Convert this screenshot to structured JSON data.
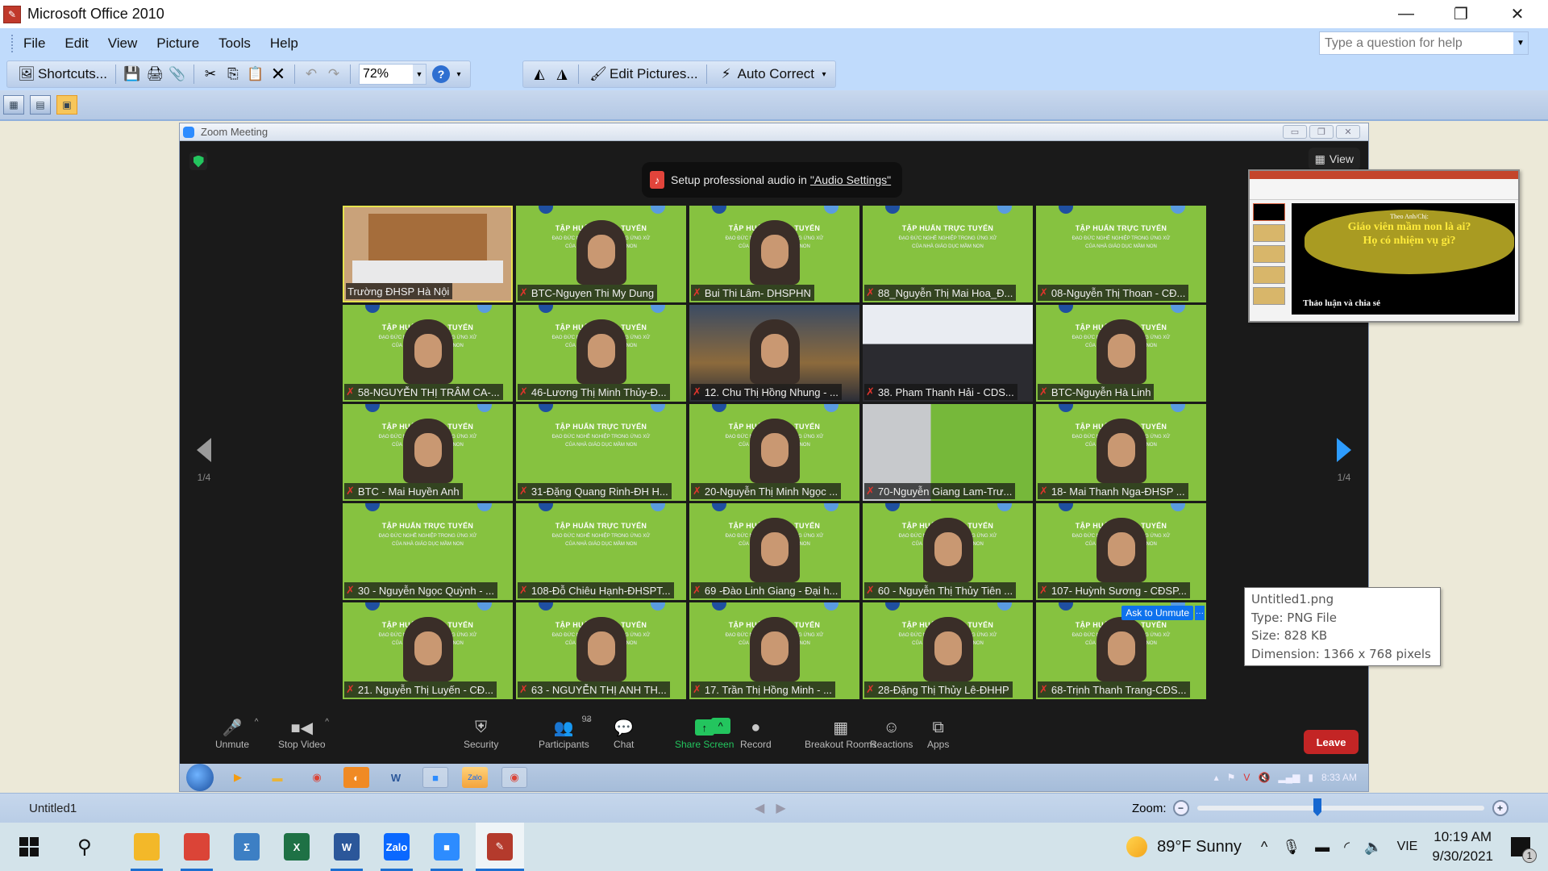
{
  "window": {
    "title": "Microsoft Office 2010",
    "app_icon": "picture-manager-icon",
    "controls": {
      "minimize": "—",
      "restore": "❐",
      "close": "✕"
    }
  },
  "menubar": {
    "items": [
      {
        "label": "File"
      },
      {
        "label": "Edit"
      },
      {
        "label": "View"
      },
      {
        "label": "Picture"
      },
      {
        "label": "Tools"
      },
      {
        "label": "Help"
      }
    ],
    "help_placeholder": "Type a question for help"
  },
  "toolbar": {
    "shortcuts_label": "Shortcuts...",
    "zoom_value": "72%",
    "edit_pictures_label": "Edit Pictures...",
    "auto_correct_label": "Auto Correct",
    "icons": [
      "save-icon",
      "print-icon",
      "attach-icon",
      "cut-icon",
      "copy-icon",
      "paste-icon",
      "delete-icon",
      "undo-icon",
      "redo-icon",
      "help-icon",
      "rotate-left-icon",
      "rotate-right-icon"
    ]
  },
  "view_buttons": [
    {
      "name": "thumbnail-view",
      "active": false
    },
    {
      "name": "filmstrip-view",
      "active": false
    },
    {
      "name": "single-picture-view",
      "active": true
    }
  ],
  "zoom_meeting": {
    "title": "Zoom Meeting",
    "audio_banner_prefix": "Setup professional audio in ",
    "audio_banner_link": "\"Audio Settings\"",
    "view_label": "View",
    "page_indicator_left": "1/4",
    "page_indicator_right": "1/4",
    "participants": [
      {
        "name": "Trường ĐHSP Hà Nội",
        "muted": false,
        "kind": "room",
        "active_speaker": true
      },
      {
        "name": "BTC-Nguyen Thi My Dung",
        "muted": true,
        "kind": "slide-person"
      },
      {
        "name": "Bui Thi Lâm- DHSPHN",
        "muted": true,
        "kind": "slide-person"
      },
      {
        "name": "88_Nguyễn Thị Mai Hoa_Đ...",
        "muted": true,
        "kind": "slide"
      },
      {
        "name": "08-Nguyễn Thị Thoan - CĐ...",
        "muted": true,
        "kind": "slide"
      },
      {
        "name": "58-NGUYỄN THỊ TRÂM CA-...",
        "muted": true,
        "kind": "slide-person"
      },
      {
        "name": "46-Lương Thị Minh Thủy-Đ...",
        "muted": true,
        "kind": "slide-person"
      },
      {
        "name": "12. Chu Thị Hồng Nhung - ...",
        "muted": true,
        "kind": "photo"
      },
      {
        "name": "38. Pham Thanh Hải - CDS...",
        "muted": true,
        "kind": "classroom"
      },
      {
        "name": "BTC-Nguyễn Hà Linh",
        "muted": true,
        "kind": "slide-person"
      },
      {
        "name": "BTC - Mai Huyền Anh",
        "muted": true,
        "kind": "slide-person"
      },
      {
        "name": "31-Đặng Quang Rinh-ĐH H...",
        "muted": true,
        "kind": "slide"
      },
      {
        "name": "20-Nguyễn Thị Minh Ngọc ...",
        "muted": true,
        "kind": "slide-person"
      },
      {
        "name": "70-Nguyễn Giang Lam-Trư...",
        "muted": true,
        "kind": "outdoor"
      },
      {
        "name": "18- Mai Thanh Nga-ĐHSP ...",
        "muted": true,
        "kind": "slide-person"
      },
      {
        "name": "30 - Nguyễn Ngọc Quỳnh - ...",
        "muted": true,
        "kind": "slide"
      },
      {
        "name": "108-Đỗ Chiêu Hạnh-ĐHSPT...",
        "muted": true,
        "kind": "slide"
      },
      {
        "name": "69 -Đào Linh Giang - Đại h...",
        "muted": true,
        "kind": "slide-person"
      },
      {
        "name": "60 - Nguyễn Thị Thủy Tiên ...",
        "muted": true,
        "kind": "slide-person"
      },
      {
        "name": "107- Huỳnh Sương - CĐSP...",
        "muted": true,
        "kind": "slide-person"
      },
      {
        "name": "21. Nguyễn Thị Luyến - CĐ...",
        "muted": true,
        "kind": "slide-person"
      },
      {
        "name": "63 - NGUYỄN THỊ ANH TH...",
        "muted": true,
        "kind": "slide-person"
      },
      {
        "name": "17. Trần Thị Hồng Minh - ...",
        "muted": true,
        "kind": "slide-person"
      },
      {
        "name": "28-Đặng Thị Thủy Lê-ĐHHP",
        "muted": true,
        "kind": "slide-person"
      },
      {
        "name": "68-Trịnh Thanh Trang-CĐS...",
        "muted": true,
        "kind": "slide-person",
        "ask_to_unmute": true
      }
    ],
    "slide_text": {
      "heading": "TẬP HUẤN TRỰC TUYẾN",
      "line1": "ĐẠO ĐỨC NGHỀ NGHIỆP TRONG ỨNG XỬ",
      "line2": "CỦA NHÀ GIÁO DỤC MẦM NON"
    },
    "ask_to_unmute_label": "Ask to Unmute",
    "more_label": "···",
    "controls": [
      {
        "label": "Unmute",
        "icon": "mic-muted-icon",
        "has_caret": true
      },
      {
        "label": "Stop Video",
        "icon": "video-camera-icon",
        "has_caret": true
      },
      {
        "label": "Security",
        "icon": "security-shield-icon"
      },
      {
        "label": "Participants",
        "icon": "participants-icon",
        "count": "93",
        "has_caret": true
      },
      {
        "label": "Chat",
        "icon": "chat-icon"
      },
      {
        "label": "Share Screen",
        "icon": "share-screen-icon",
        "has_caret": true
      },
      {
        "label": "Record",
        "icon": "record-icon"
      },
      {
        "label": "Breakout Rooms",
        "icon": "breakout-rooms-icon"
      },
      {
        "label": "Reactions",
        "icon": "reactions-icon"
      },
      {
        "label": "Apps",
        "icon": "apps-icon"
      }
    ],
    "leave_label": "Leave",
    "inner_taskbar": {
      "apps": [
        "media-player-icon",
        "file-explorer-icon",
        "chrome-icon",
        "orange-app-icon",
        "word-icon",
        "zoom-icon",
        "zalo-icon",
        "chrome-icon"
      ],
      "clock": "8:33 AM"
    }
  },
  "ppt_preview": {
    "slide_subtitle": "Theo Anh/Chị:",
    "slide_question1": "Giáo viên mầm non là ai?",
    "slide_question2": "Họ có nhiệm vụ gì?",
    "slide_footer": "Thảo luận và chia sẻ"
  },
  "tooltip": {
    "filename": "Untitled1.png",
    "type": "Type: PNG File",
    "size": "Size: 828 KB",
    "dimension": "Dimension: 1366 x 768 pixels"
  },
  "statusbar": {
    "filename": "Untitled1",
    "zoom_label": "Zoom:",
    "zoom_slider_fraction": 0.42
  },
  "taskbar": {
    "apps": [
      {
        "name": "file-explorer",
        "label": "",
        "color": "#f3b829"
      },
      {
        "name": "chrome",
        "label": "",
        "color": "#db4437"
      },
      {
        "name": "calculator-app",
        "label": "Σ",
        "color": "#3d7fc4"
      },
      {
        "name": "excel",
        "label": "X",
        "color": "#1e7145"
      },
      {
        "name": "word",
        "label": "W",
        "color": "#2b579a"
      },
      {
        "name": "zalo",
        "label": "Zalo",
        "color": "#0a68ff"
      },
      {
        "name": "zoom",
        "label": "■",
        "color": "#2d8cff"
      },
      {
        "name": "picture-manager",
        "label": "✎",
        "color": "#b43a2c"
      }
    ],
    "weather": "89°F  Sunny",
    "language": "VIE",
    "time": "10:19 AM",
    "date": "9/30/2021",
    "notification_count": "1"
  }
}
